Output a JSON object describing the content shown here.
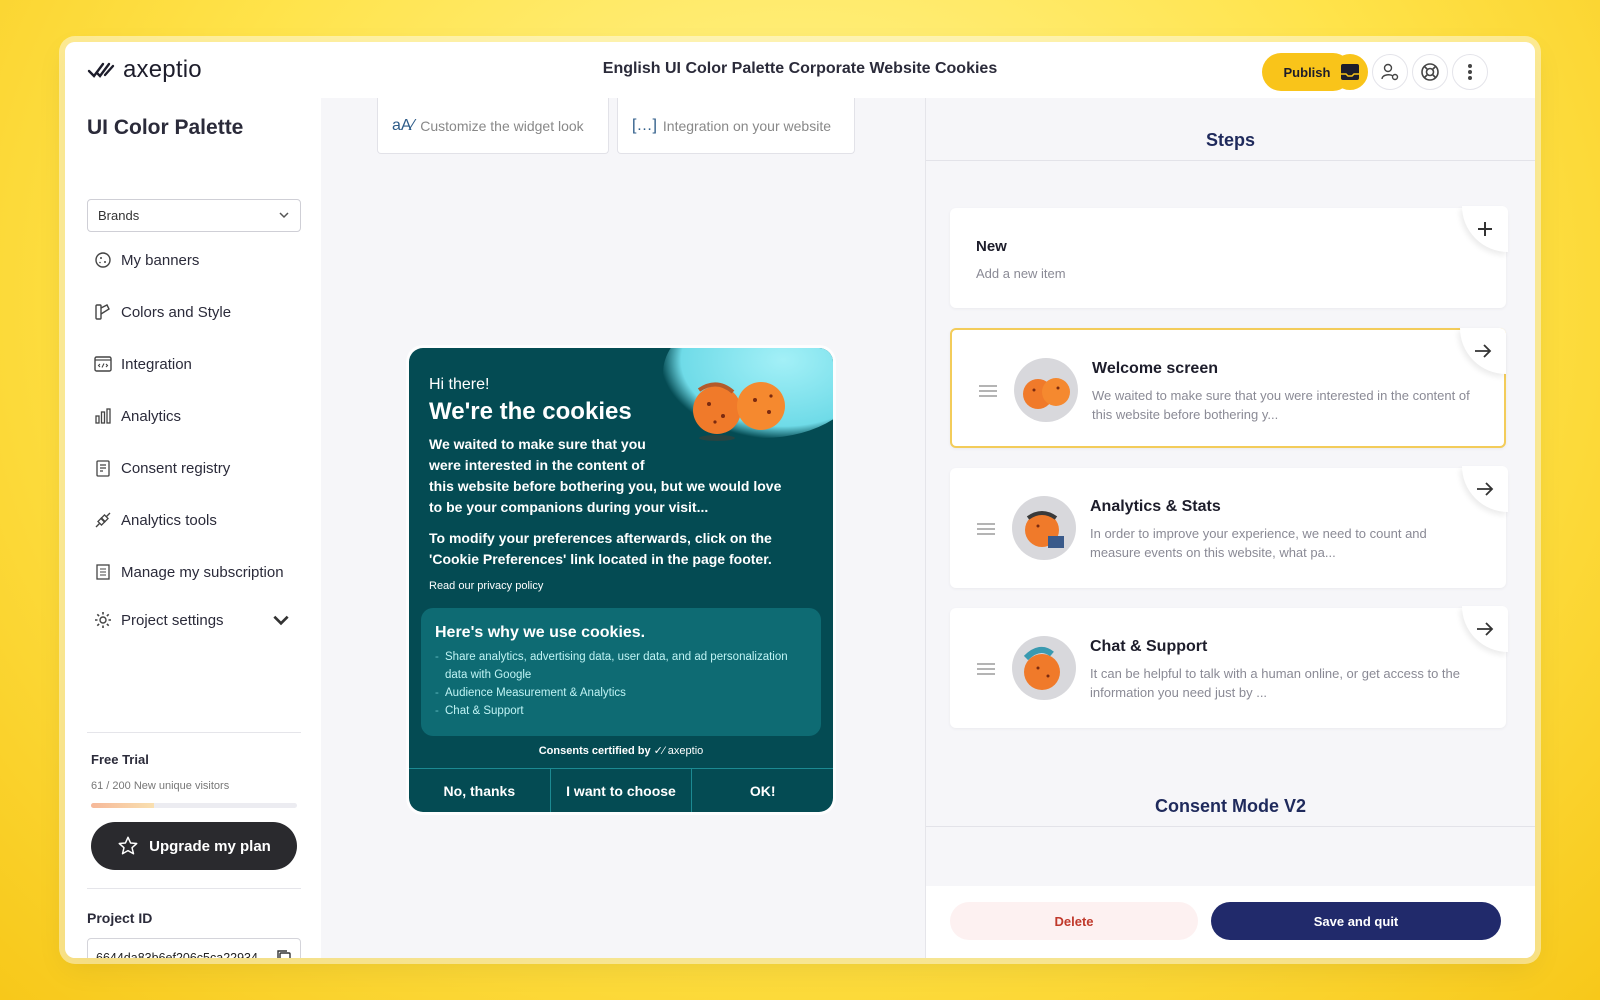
{
  "brand": {
    "name": "axeptio",
    "accent": "#f9c41a",
    "navy": "#212a6b",
    "teal": "#044b53"
  },
  "header": {
    "title": "English UI Color Palette Corporate Website Cookies",
    "publish_label": "Publish",
    "icons": [
      "inbox-icon",
      "user-settings-icon",
      "help-icon",
      "more-vertical-icon"
    ]
  },
  "sidebar": {
    "project_title": "UI Color Palette",
    "select_value": "Brands",
    "items": [
      {
        "label": "My banners",
        "icon": "cookie-icon"
      },
      {
        "label": "Colors and Style",
        "icon": "palette-icon"
      },
      {
        "label": "Integration",
        "icon": "code-window-icon"
      },
      {
        "label": "Analytics",
        "icon": "bar-chart-icon"
      },
      {
        "label": "Consent registry",
        "icon": "registry-icon"
      },
      {
        "label": "Analytics tools",
        "icon": "plug-icon"
      },
      {
        "label": "Manage my subscription",
        "icon": "receipt-icon"
      },
      {
        "label": "Project settings",
        "icon": "gear-icon"
      }
    ],
    "trial": {
      "label": "Free Trial",
      "usage": "61 / 200 New unique visitors",
      "progress": 0.305
    },
    "upgrade_label": "Upgrade my plan",
    "project_id_label": "Project ID",
    "project_id": "6644da83b6ef206c5ca22934"
  },
  "middle": {
    "tabs": [
      {
        "glyph": "aA⁄",
        "label": "Customize the widget look"
      },
      {
        "glyph": "[…]",
        "label": "Integration on your website"
      }
    ],
    "banner": {
      "greeting": "Hi there!",
      "heading": "We're the cookies",
      "intro_lines": [
        "We waited to make sure that you",
        "were interested in the content of",
        "this website before bothering you, but we would love",
        "to be your companions during your visit..."
      ],
      "modify_text": "To modify your preferences afterwards, click on the 'Cookie Preferences' link located in the page footer.",
      "privacy_link": "Read our privacy policy",
      "why_title": "Here's why we use cookies.",
      "why_items": [
        "Share analytics, advertising data, user data, and ad personalization data with Google",
        "Audience Measurement & Analytics",
        "Chat & Support"
      ],
      "certified": "Consents certified by",
      "certified_brand": "axeptio",
      "buttons": {
        "no": "No, thanks",
        "choose": "I want to choose",
        "ok": "OK!"
      }
    }
  },
  "right": {
    "steps_title": "Steps",
    "new_item": {
      "title": "New",
      "subtitle": "Add a new item"
    },
    "steps": [
      {
        "title": "Welcome screen",
        "desc": "We waited to make sure that you were interested in the content of this website before bothering y..."
      },
      {
        "title": "Analytics & Stats",
        "desc": "In order to improve your experience, we need to count and measure events on this website, what pa..."
      },
      {
        "title": "Chat & Support",
        "desc": "It can be helpful to talk with a human online, or get access to the information you need just by ..."
      }
    ],
    "consent_title": "Consent Mode V2",
    "delete_label": "Delete",
    "save_label": "Save and quit"
  }
}
